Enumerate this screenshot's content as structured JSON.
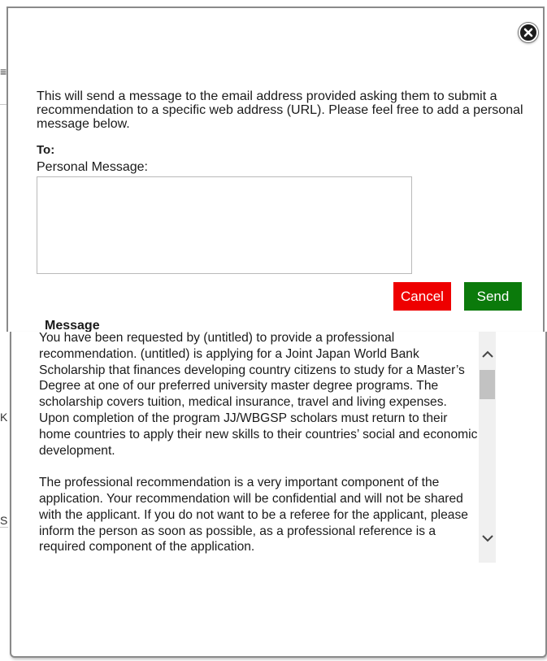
{
  "dialog": {
    "intro_text": "This will send a message to the email address provided asking them to submit a recommendation to a specific web address (URL). Please feel free to add a personal message below.",
    "to_label": "To:",
    "personal_message_label": "Personal Message:",
    "personal_message_value": "",
    "cancel_label": "Cancel",
    "send_label": "Send",
    "message_label": "Message",
    "message_paragraphs": [
      "You have been requested by (untitled) to provide a professional recommendation. (untitled) is applying for a Joint Japan World Bank Scholarship that finances developing country citizens to study for a Master’s Degree at one of our preferred university master degree programs. The scholarship covers tuition, medical insurance, travel and living expenses. Upon completion of the program JJ/WBGSP scholars must return to their home countries to apply their new skills to their countries’ social and economic development.",
      "The professional recommendation is a very important component of the application. Your recommendation will be confidential and will not be shared with the applicant. If you do not want to be a referee for the applicant, please inform the person as soon as possible, as a professional reference is a required component of the application."
    ]
  },
  "icons": {
    "close": "close-icon",
    "scroll_up": "chevron-up-icon",
    "scroll_down": "chevron-down-icon"
  },
  "colors": {
    "cancel": "#ee0000",
    "send": "#0b7a0b",
    "border": "#8a8a8a"
  },
  "background_fragments": [
    "≡",
    "K",
    "S"
  ]
}
